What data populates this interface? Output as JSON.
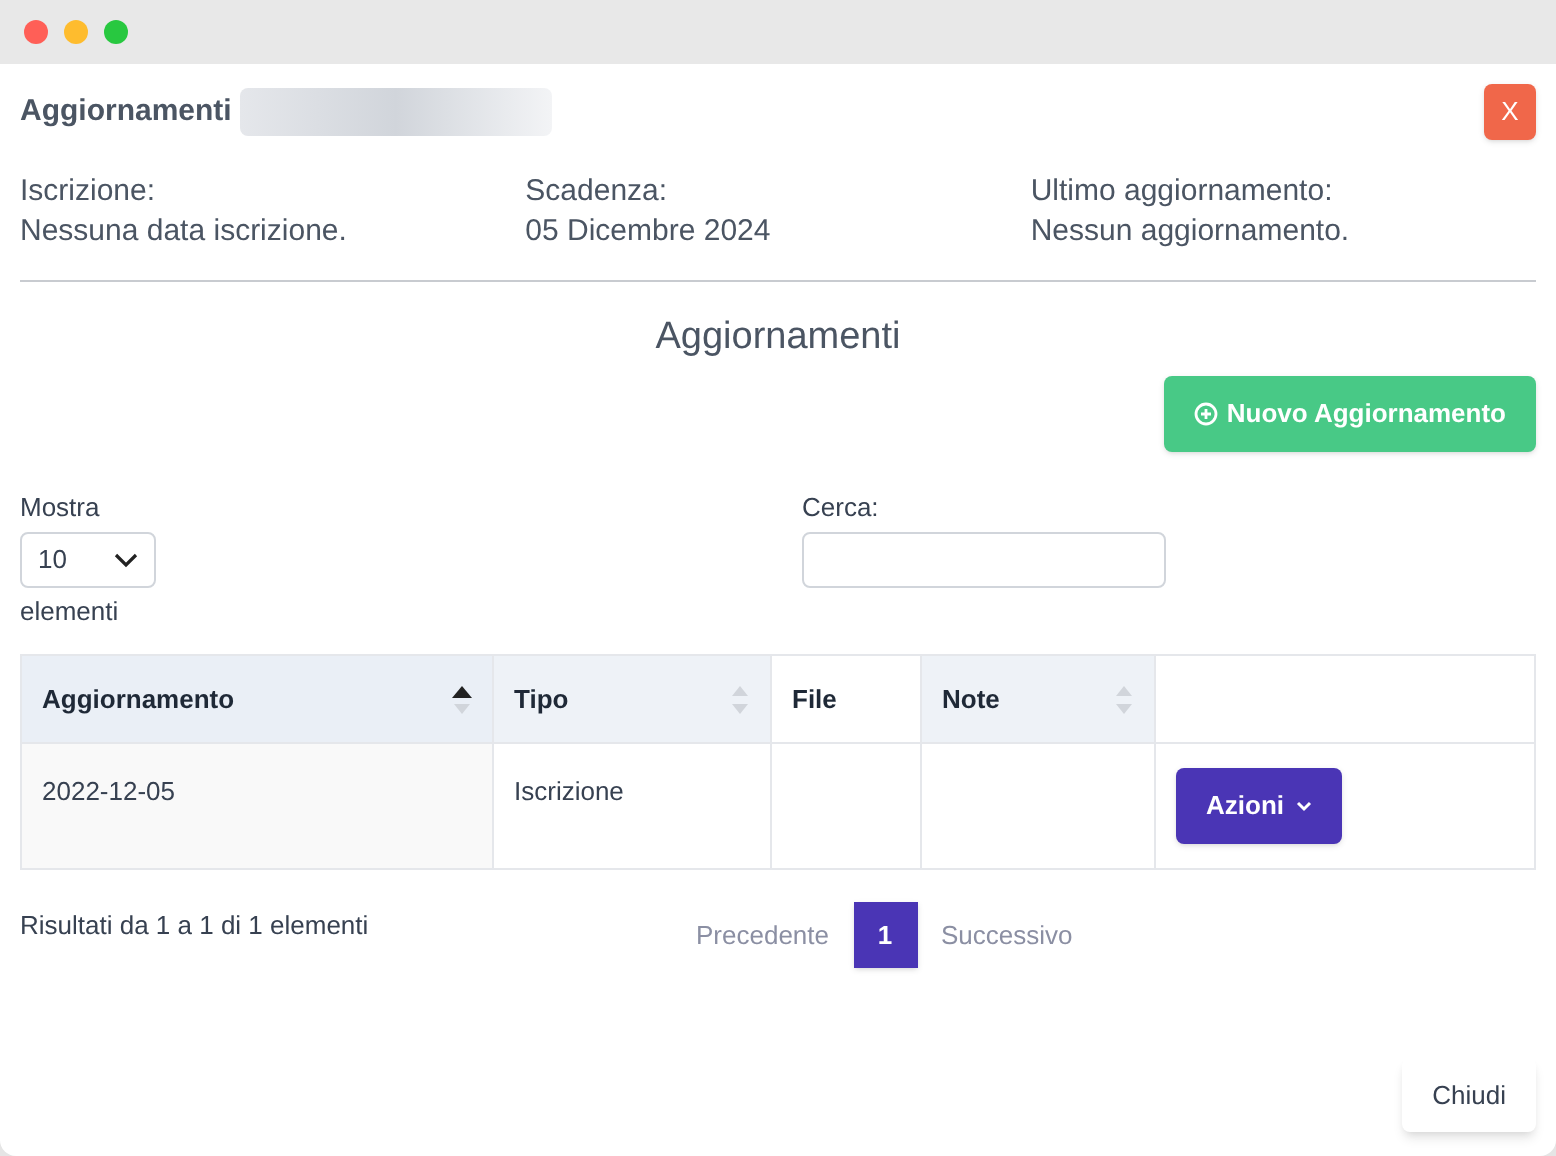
{
  "dialog": {
    "title": "Aggiornamenti",
    "close_label": "X"
  },
  "info": [
    {
      "label": "Iscrizione:",
      "value": "Nessuna data iscrizione."
    },
    {
      "label": "Scadenza:",
      "value": "05 Dicembre 2024"
    },
    {
      "label": "Ultimo aggiornamento:",
      "value": "Nessun aggiornamento."
    }
  ],
  "section_title": "Aggiornamenti",
  "new_button": "Nuovo Aggiornamento",
  "length": {
    "label": "Mostra",
    "value": "10",
    "suffix": "elementi"
  },
  "search": {
    "label": "Cerca:"
  },
  "table": {
    "columns": [
      {
        "label": "Aggiornamento",
        "sortable": true,
        "sorted": true
      },
      {
        "label": "Tipo",
        "sortable": true,
        "sorted": false
      },
      {
        "label": "File",
        "sortable": false
      },
      {
        "label": "Note",
        "sortable": true,
        "sorted": false
      }
    ],
    "rows": [
      {
        "cells": [
          "2022-12-05",
          "Iscrizione",
          "",
          ""
        ],
        "action": "Azioni"
      }
    ]
  },
  "info_text": "Risultati da 1 a 1 di 1 elementi",
  "pagination": {
    "previous": "Precedente",
    "pages": [
      {
        "label": "1",
        "selected": true
      }
    ],
    "next": "Successivo"
  },
  "close_button": "Chiudi"
}
